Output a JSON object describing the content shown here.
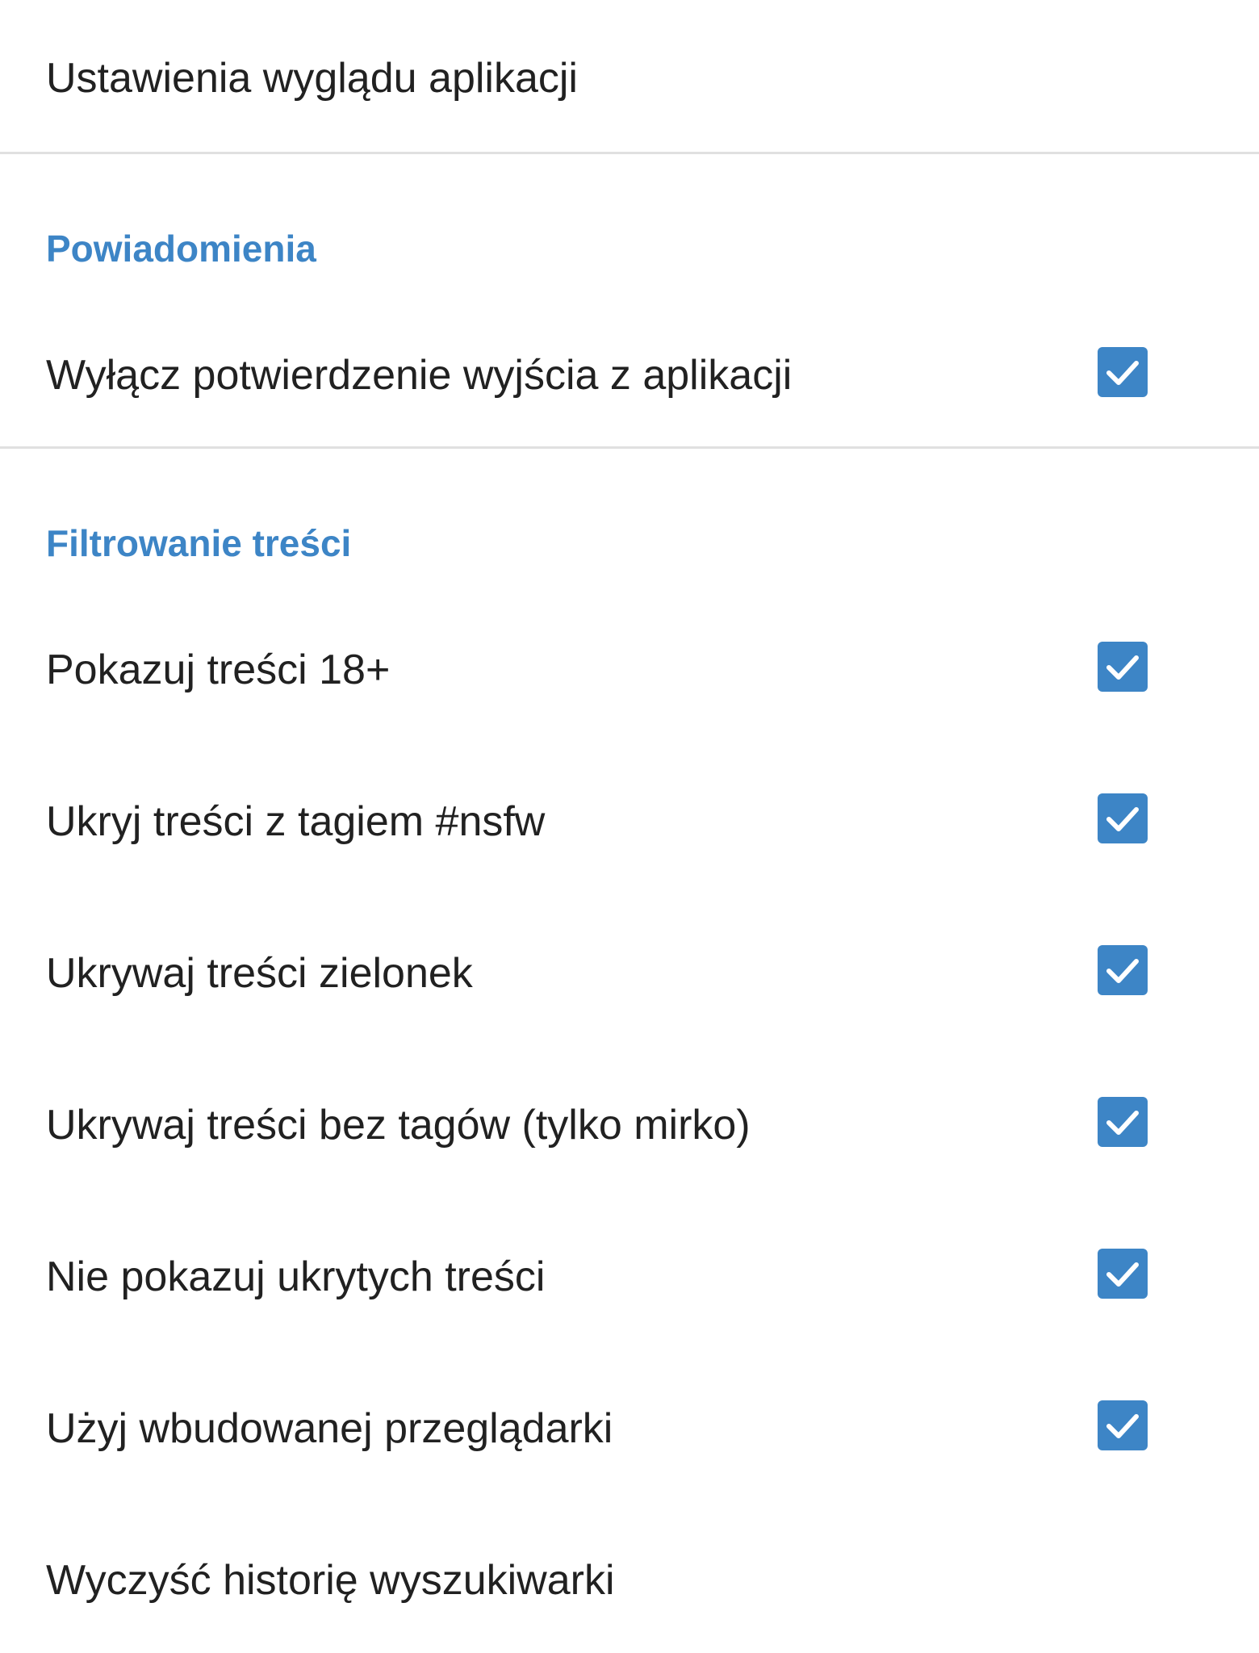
{
  "items": {
    "appearance": {
      "label": "Ustawienia wyglądu aplikacji"
    },
    "section_notifications": {
      "title": "Powiadomienia"
    },
    "disable_exit_confirm": {
      "label": "Wyłącz potwierdzenie wyjścia z aplikacji",
      "checked": true
    },
    "section_filtering": {
      "title": "Filtrowanie treści"
    },
    "show_18": {
      "label": "Pokazuj treści 18+",
      "checked": true
    },
    "hide_nsfw": {
      "label": "Ukryj treści z tagiem #nsfw",
      "checked": true
    },
    "hide_green": {
      "label": "Ukrywaj treści zielonek",
      "checked": true
    },
    "hide_untagged": {
      "label": "Ukrywaj treści bez tagów (tylko mirko)",
      "checked": true
    },
    "dont_show_hidden": {
      "label": "Nie pokazuj ukrytych treści",
      "checked": true
    },
    "builtin_browser": {
      "label": "Użyj wbudowanej przeglądarki",
      "checked": true
    },
    "clear_search_history": {
      "label": "Wyczyść historię wyszukiwarki"
    }
  },
  "colors": {
    "accent": "#3d85c6",
    "text": "#212121",
    "divider": "#e0e0e0",
    "background": "#ffffff"
  },
  "icons": {
    "checkbox": "checkmark-icon"
  }
}
